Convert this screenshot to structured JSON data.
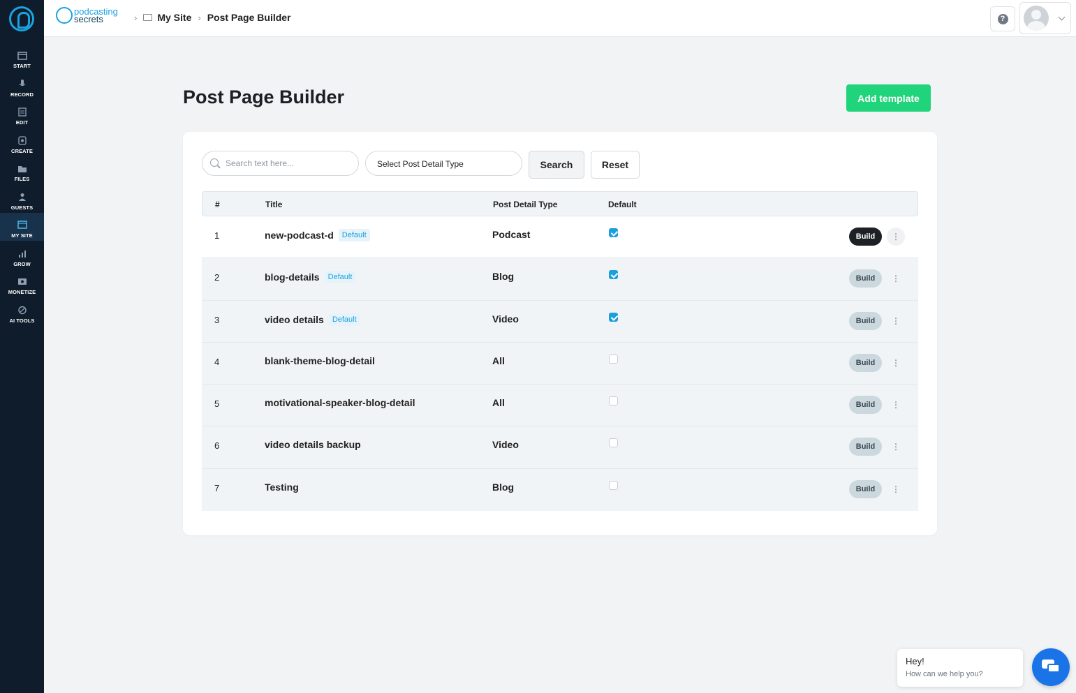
{
  "sidebar": {
    "items": [
      {
        "label": "START",
        "icon": "calendar-icon"
      },
      {
        "label": "RECORD",
        "icon": "microphone-icon"
      },
      {
        "label": "EDIT",
        "icon": "edit-icon"
      },
      {
        "label": "CREATE",
        "icon": "create-icon"
      },
      {
        "label": "FILES",
        "icon": "files-icon"
      },
      {
        "label": "GUESTS",
        "icon": "guests-icon"
      },
      {
        "label": "MY SITE",
        "icon": "site-icon"
      },
      {
        "label": "GROW",
        "icon": "chart-icon"
      },
      {
        "label": "MONETIZE",
        "icon": "monetize-icon"
      },
      {
        "label": "AI TOOLS",
        "icon": "ai-icon"
      }
    ],
    "active": "MY SITE"
  },
  "header": {
    "brand_line1": "podcasting",
    "brand_line2": "secrets",
    "breadcrumb": {
      "link": "My Site",
      "current": "Post Page Builder"
    },
    "help_icon": "?"
  },
  "main": {
    "title": "Post Page Builder",
    "add_button": "Add template",
    "search_placeholder": "Search text here...",
    "type_select": "Select Post Detail Type",
    "search_button": "Search",
    "reset_button": "Reset"
  },
  "table": {
    "headers": {
      "num": "#",
      "title": "Title",
      "type": "Post Detail Type",
      "default": "Default"
    },
    "build_label": "Build",
    "badge_label": "Default",
    "rows": [
      {
        "num": "1",
        "title": "new-podcast-d",
        "badge": true,
        "type": "Podcast",
        "checked": true
      },
      {
        "num": "2",
        "title": "blog-details",
        "badge": true,
        "type": "Blog",
        "checked": true
      },
      {
        "num": "3",
        "title": "video details",
        "badge": true,
        "type": "Video",
        "checked": true
      },
      {
        "num": "4",
        "title": "blank-theme-blog-detail",
        "badge": false,
        "type": "All",
        "checked": false
      },
      {
        "num": "5",
        "title": "motivational-speaker-blog-detail",
        "badge": false,
        "type": "All",
        "checked": false
      },
      {
        "num": "6",
        "title": "video details backup",
        "badge": false,
        "type": "Video",
        "checked": false
      },
      {
        "num": "7",
        "title": "Testing",
        "badge": false,
        "type": "Blog",
        "checked": false
      }
    ]
  },
  "chat": {
    "greeting": "Hey!",
    "prompt": "How can we help you?"
  },
  "colors": {
    "sidebar": "#0f1c2b",
    "accent": "#1ba0db",
    "add_button": "#1fd47a",
    "chat": "#1a74e8"
  }
}
